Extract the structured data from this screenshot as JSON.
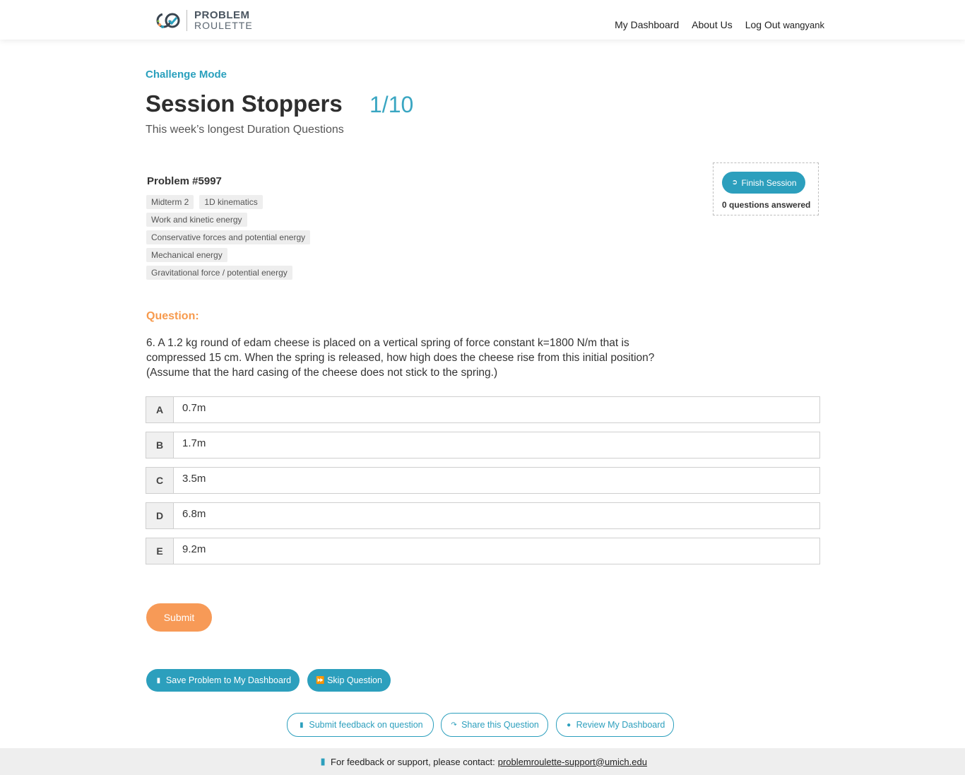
{
  "header": {
    "logo_line1": "PROBLEM",
    "logo_line2": "ROULETTE",
    "nav": {
      "dashboard": "My Dashboard",
      "about": "About Us",
      "logout": "Log Out",
      "username": "wangyank"
    }
  },
  "session": {
    "mode": "Challenge Mode",
    "title": "Session Stoppers",
    "counter": "1/10",
    "subtitle": "This week’s longest Duration Questions"
  },
  "problem": {
    "id": "Problem #5997",
    "tags": [
      "Midterm 2",
      "1D kinematics",
      "Work and kinetic energy",
      "Conservative forces and potential energy",
      "Mechanical energy",
      "Gravitational force / potential energy"
    ]
  },
  "finish": {
    "button": "Finish Session",
    "answered": "0 questions answered"
  },
  "question": {
    "label": "Question:",
    "text": "6. A 1.2 kg round of edam cheese is placed on a vertical spring of force constant k=1800 N/m that is compressed 15 cm. When the spring is released, how high does the cheese rise from this initial position? (Assume that the hard casing of the cheese does not stick to the spring.)",
    "choices": [
      {
        "letter": "A",
        "value": "0.7m"
      },
      {
        "letter": "B",
        "value": "1.7m"
      },
      {
        "letter": "C",
        "value": "3.5m"
      },
      {
        "letter": "D",
        "value": "6.8m"
      },
      {
        "letter": "E",
        "value": "9.2m"
      }
    ]
  },
  "actions": {
    "submit": "Submit",
    "save": "Save Problem to My Dashboard",
    "skip": "Skip Question",
    "feedback": "Submit feedback on question",
    "share": "Share this Question",
    "review": "Review My Dashboard"
  },
  "footer": {
    "text": "For feedback or support, please contact:",
    "email": "problemroulette-support@umich.edu"
  },
  "colors": {
    "accent": "#2c9fbd",
    "orange": "#f79a57"
  }
}
